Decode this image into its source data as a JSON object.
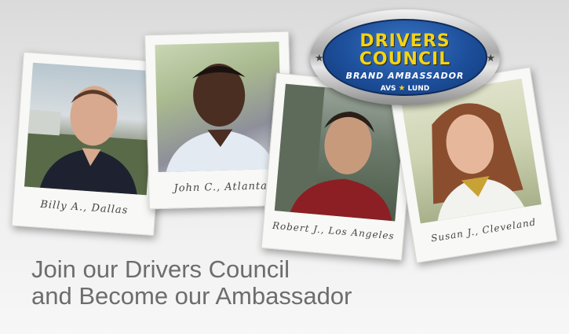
{
  "badge": {
    "line1": "DRIVERS",
    "line2": "COUNCIL",
    "line3": "BRAND AMBASSADOR",
    "brand_left": "AVS",
    "brand_right": "LUND"
  },
  "polaroids": [
    {
      "caption": "Billy A., Dallas"
    },
    {
      "caption": "John C., Atlanta"
    },
    {
      "caption": "Robert J., Los Angeles"
    },
    {
      "caption": "Susan J., Cleveland"
    }
  ],
  "headline": {
    "line1": "Join our Drivers Council",
    "line2": "and Become our Ambassador"
  },
  "colors": {
    "badge_text": "#f4d313",
    "badge_bg": "#1d4f9b",
    "headline": "#6d6d6d"
  }
}
